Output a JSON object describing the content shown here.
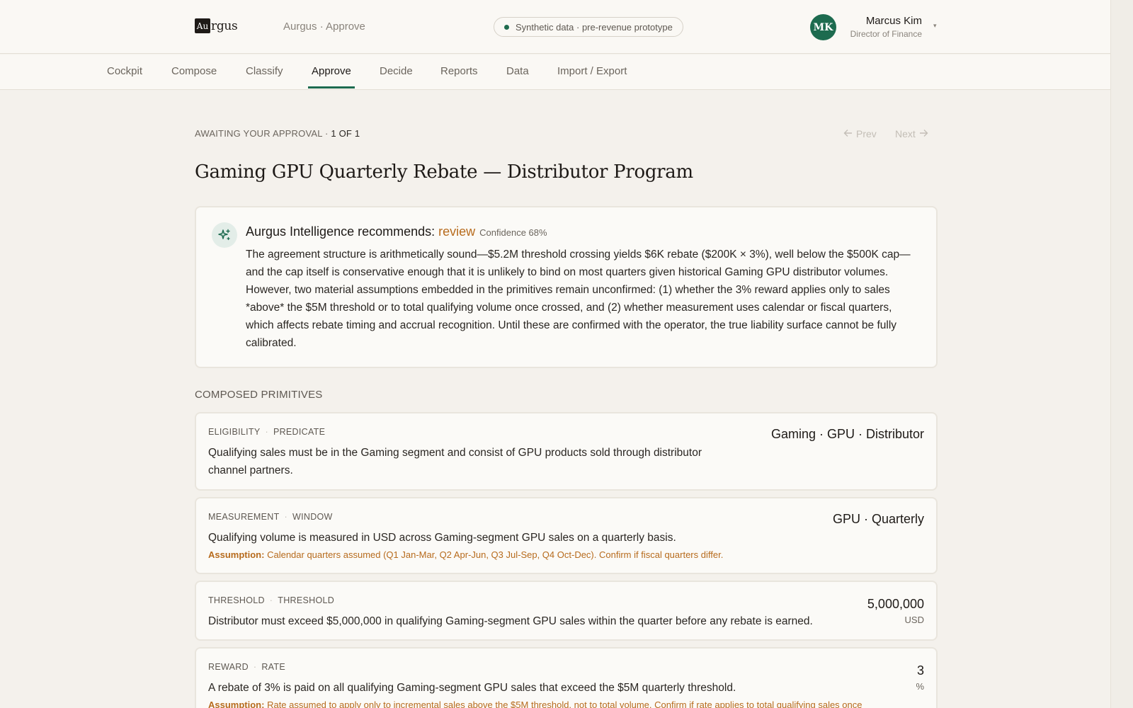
{
  "header": {
    "logo_box": "Au",
    "logo_rest": "rgus",
    "app_name": "Aurgus · Approve",
    "pill_text": "Synthetic data · pre-revenue prototype",
    "user": {
      "initials": "MK",
      "name": "Marcus Kim",
      "role": "Director of Finance",
      "caret": "▾"
    }
  },
  "nav": {
    "items": [
      "Cockpit",
      "Compose",
      "Classify",
      "Approve",
      "Decide",
      "Reports",
      "Data",
      "Import / Export"
    ],
    "active": "Approve"
  },
  "crumb": {
    "label": "AWAITING YOUR APPROVAL · ",
    "count": "1 OF 1"
  },
  "pager": {
    "prev": "Prev",
    "next": "Next"
  },
  "title": "Gaming GPU Quarterly Rebate — Distributor Program",
  "recommendation": {
    "lead": "Aurgus Intelligence recommends: ",
    "verdict": "review",
    "confidence": "Confidence 68%",
    "body": "The agreement structure is arithmetically sound—$5.2M threshold crossing yields $6K rebate ($200K × 3%), well below the $500K cap—and the cap itself is conservative enough that it is unlikely to bind on most quarters given historical Gaming GPU distributor volumes. However, two material assumptions embedded in the primitives remain unconfirmed: (1) whether the 3% reward applies only to sales *above* the $5M threshold or to total qualifying volume once crossed, and (2) whether measurement uses calendar or fiscal quarters, which affects rebate timing and accrual recognition. Until these are confirmed with the operator, the true liability surface cannot be fully calibrated."
  },
  "section_label": "COMPOSED PRIMITIVES",
  "primitives": [
    {
      "kind": "ELIGIBILITY",
      "type": "PREDICATE",
      "text": "Qualifying sales must be in the Gaming segment and consist of GPU products sold through distributor channel partners.",
      "value": "Gaming · GPU · Distributor",
      "unit": null,
      "assumption": null
    },
    {
      "kind": "MEASUREMENT",
      "type": "WINDOW",
      "text": "Qualifying volume is measured in USD across Gaming-segment GPU sales on a quarterly basis.",
      "value": "GPU · Quarterly",
      "unit": null,
      "assumption_label": "Assumption:",
      "assumption": "Calendar quarters assumed (Q1 Jan-Mar, Q2 Apr-Jun, Q3 Jul-Sep, Q4 Oct-Dec). Confirm if fiscal quarters differ."
    },
    {
      "kind": "THRESHOLD",
      "type": "THRESHOLD",
      "text": "Distributor must exceed $5,000,000 in qualifying Gaming-segment GPU sales within the quarter before any rebate is earned.",
      "value": "5,000,000",
      "unit": "USD",
      "assumption": null
    },
    {
      "kind": "REWARD",
      "type": "RATE",
      "text": "A rebate of 3% is paid on all qualifying Gaming-segment GPU sales that exceed the $5M quarterly threshold.",
      "value": "3",
      "unit": "%",
      "assumption_label": "Assumption:",
      "assumption": "Rate assumed to apply only to incremental sales above the $5M threshold, not to total volume. Confirm if rate applies to total qualifying sales once"
    }
  ],
  "colors": {
    "accent": "#1d6b4f",
    "warning": "#b76b1d",
    "background": "#f4f1ec"
  },
  "icons": {
    "recommendation": "sparkle-icon",
    "prev": "arrow-left-icon",
    "next": "arrow-right-icon"
  }
}
